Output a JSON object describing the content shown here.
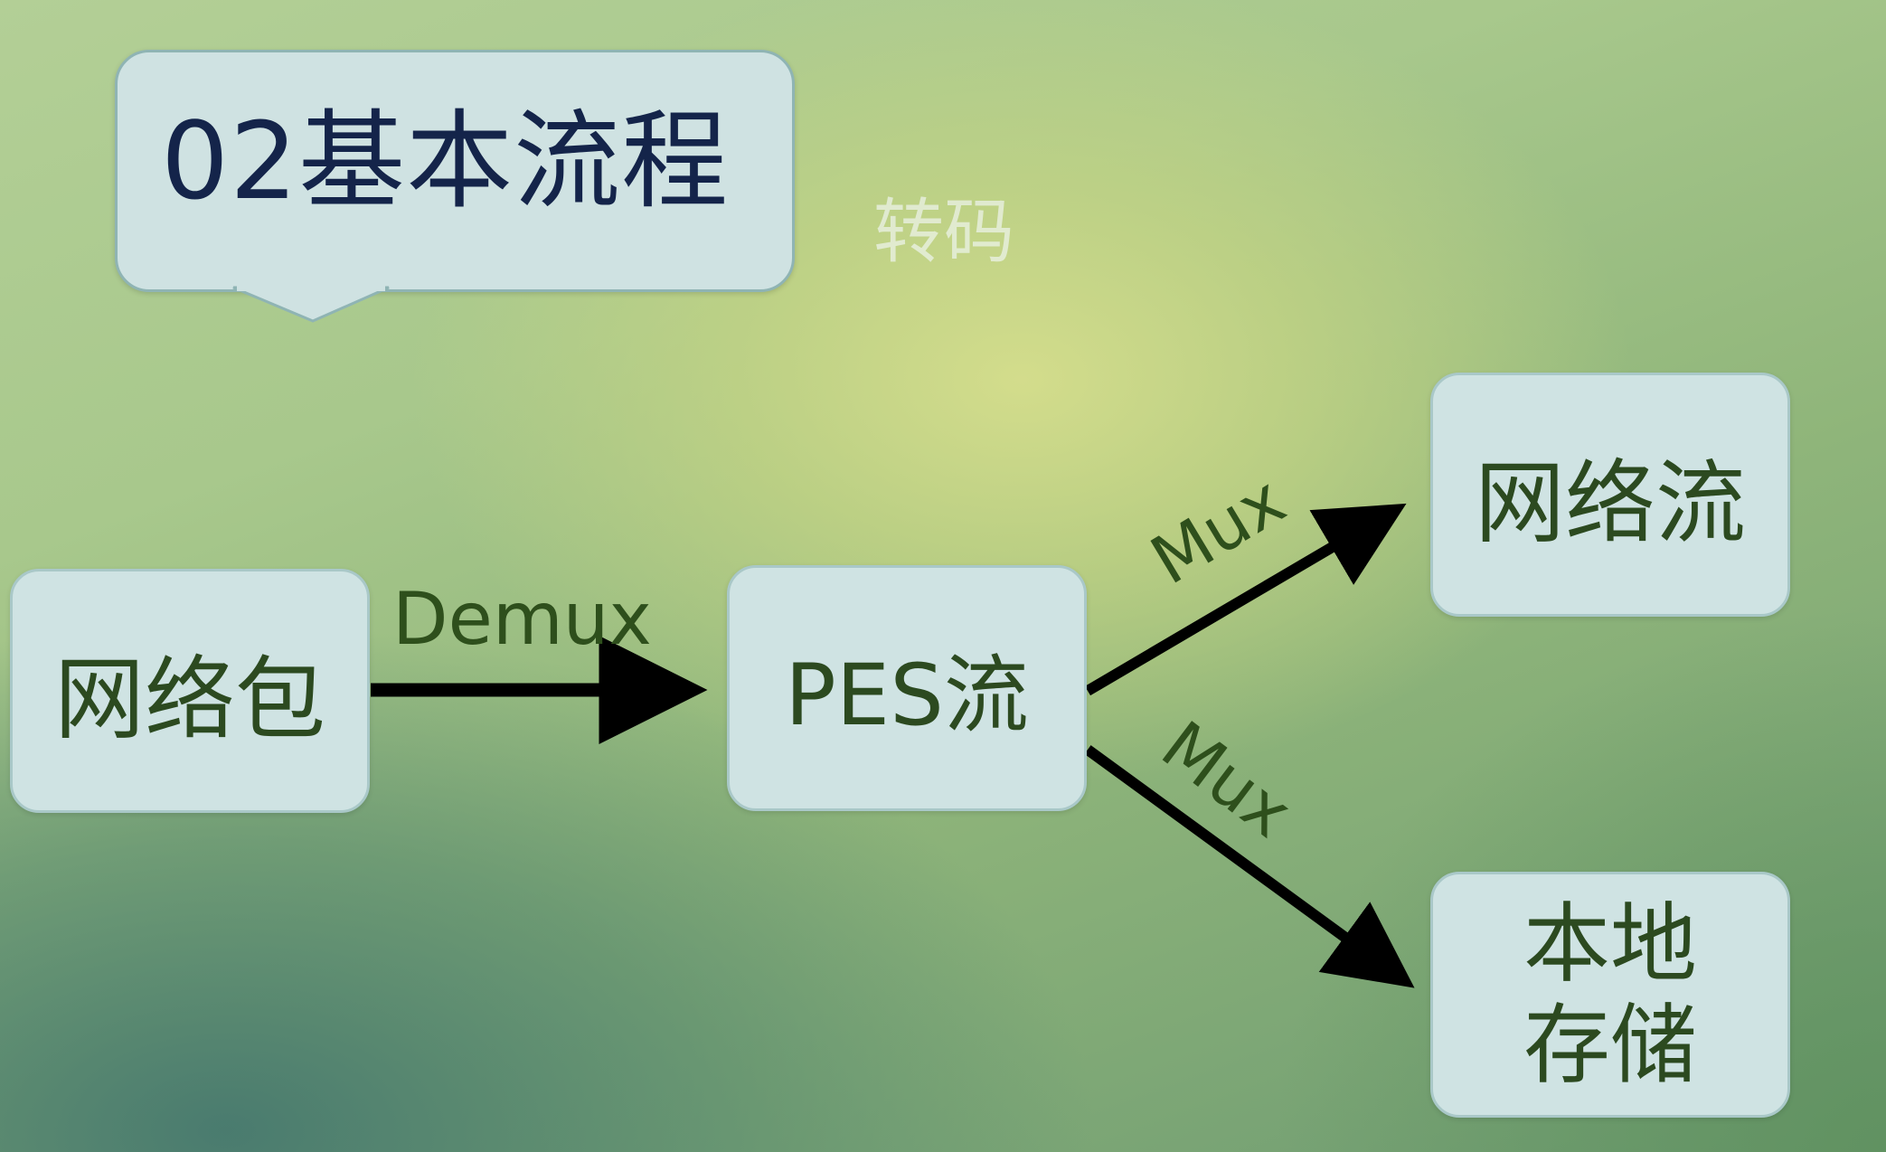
{
  "title": "02基本流程",
  "subtitle_faint": "转码",
  "nodes": {
    "packet": "网络包",
    "pes": "PES流",
    "network_stream": "网络流",
    "local_storage": "本地存储"
  },
  "edges": {
    "demux": "Demux",
    "mux_up": "Mux",
    "mux_down": "Mux"
  },
  "colors": {
    "node_fill": "#cfe3e3",
    "node_text": "#2c4a20",
    "title_text": "#14244a",
    "arrow": "#000000"
  }
}
